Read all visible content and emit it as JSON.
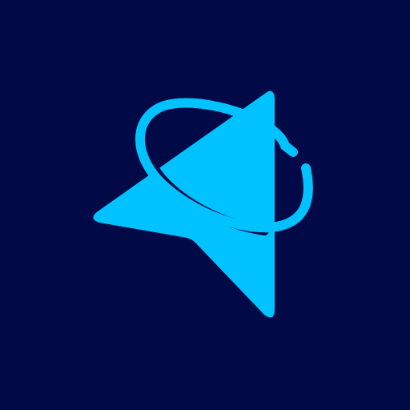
{
  "background_color": "#010a47",
  "logo": {
    "icon": "paper-plane-orbit-icon",
    "accent_color": "#00c2ff",
    "background_color": "#010a47"
  }
}
